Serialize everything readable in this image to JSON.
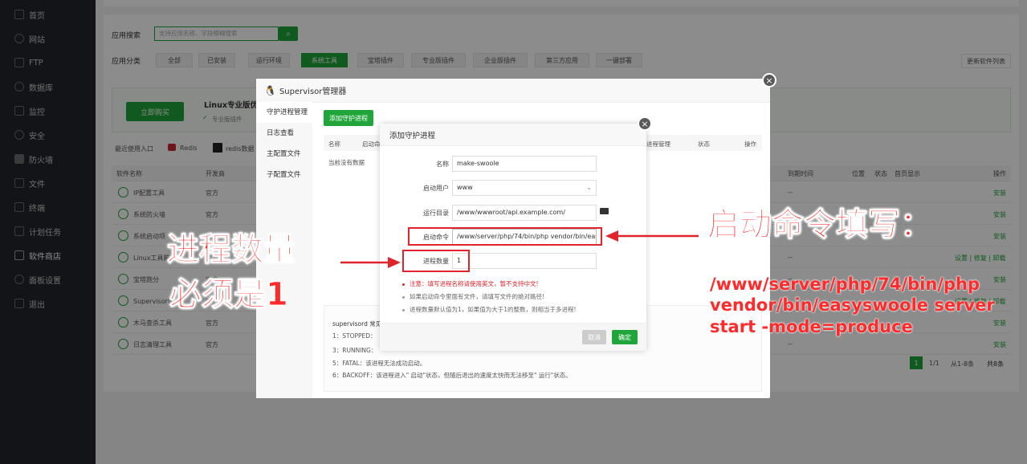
{
  "sidebar": {
    "items": [
      {
        "label": "首页",
        "icon": "home-icon"
      },
      {
        "label": "网站",
        "icon": "globe-icon"
      },
      {
        "label": "FTP",
        "icon": "ftp-icon"
      },
      {
        "label": "数据库",
        "icon": "database-icon"
      },
      {
        "label": "监控",
        "icon": "monitor-icon"
      },
      {
        "label": "安全",
        "icon": "shield-icon"
      },
      {
        "label": "防火墙",
        "icon": "firewall-icon"
      },
      {
        "label": "文件",
        "icon": "folder-icon"
      },
      {
        "label": "终端",
        "icon": "terminal-icon"
      },
      {
        "label": "计划任务",
        "icon": "calendar-icon"
      },
      {
        "label": "软件商店",
        "icon": "grid-icon"
      },
      {
        "label": "面板设置",
        "icon": "gear-icon"
      },
      {
        "label": "退出",
        "icon": "logout-icon"
      }
    ]
  },
  "store": {
    "search_label": "应用搜索",
    "search_placeholder": "支持应用名称、字段模糊搜索",
    "category_label": "应用分类",
    "categories": [
      "全部",
      "已安装",
      "运行环境",
      "系统工具",
      "宝塔插件",
      "专业版插件",
      "企业版插件",
      "第三方应用",
      "一键部署"
    ],
    "active_category": "系统工具",
    "update_list_button": "更新软件列表",
    "buy_button": "立即购买",
    "promo_title": "Linux专业版优",
    "promo_sub": "专业版插件",
    "recent_label": "最近使用入口",
    "recent_items": [
      "Redis",
      "redis数据"
    ],
    "table_headers": [
      "软件名称",
      "开发商",
      "到期时间",
      "位置",
      "状态",
      "首页显示",
      "操作"
    ],
    "rows": [
      {
        "name": "IP配置工具",
        "dev": "官方",
        "expire": "--",
        "op": "安装"
      },
      {
        "name": "系统防火墙",
        "dev": "官方",
        "expire": "--",
        "op": "安装"
      },
      {
        "name": "系统启动项",
        "dev": "官方",
        "expire": "--",
        "op": "安装"
      },
      {
        "name": "Linux工具箱",
        "dev": "官方",
        "expire": "--",
        "op": "设置 | 修复 | 卸载"
      },
      {
        "name": "宝塔跑分",
        "dev": "官方",
        "expire": "--",
        "op": "安装"
      },
      {
        "name": "Supervisor管",
        "dev": "官方",
        "expire": "--",
        "op": "设置 | 修复 | 卸载"
      },
      {
        "name": "木马查杀工具",
        "dev": "官方",
        "expire": "--",
        "op": "安装"
      },
      {
        "name": "日志清理工具",
        "dev": "官方",
        "expire": "--",
        "op": "安装"
      }
    ],
    "pagination": {
      "page": "1",
      "total_pages": "1/1",
      "range": "从1-8条",
      "count": "共8条"
    }
  },
  "supervisor": {
    "title": "Supervisor管理器",
    "menu": [
      "守护进程管理",
      "日志查看",
      "主配置文件",
      "子配置文件"
    ],
    "add_button": "添加守护进程",
    "table_headers": [
      "名称",
      "启动命",
      "进程管理",
      "状态",
      "操作"
    ],
    "empty_text": "当前没有数据",
    "status_title": "supervisord 常见",
    "status_lines": [
      "1：STOPPED：",
      "3：RUNNING：",
      "5：FATAL：该进程无法成功启动。",
      "6：BACKOFF：该进程进入\" 启动\"状态，但随后退出的速度太快而无法移至\" 运行\"状态。"
    ]
  },
  "dialog": {
    "title": "添加守护进程",
    "fields": {
      "name_label": "名称",
      "name_value": "make-swoole",
      "user_label": "启动用户",
      "user_value": "www",
      "dir_label": "运行目录",
      "dir_value": "/www/wwwroot/api.example.com/",
      "cmd_label": "启动命令",
      "cmd_value": "/www/server/php/74/bin/php vendor/bin/easyswo",
      "count_label": "进程数量",
      "count_value": "1"
    },
    "notes": [
      "注意：填写进程名称请使用英文，暂不支持中文!",
      "如果启动命令里面有文件，请填写文件的绝对路径!",
      "进程数量默认值为1，如果值为大于1的整数，则相当于多进程!"
    ],
    "cancel_button": "取消",
    "confirm_button": "确定"
  },
  "annotations": {
    "left_line1": "进程数量",
    "left_line2": "必须是1",
    "right_title": "启动命令填写：",
    "cmd_line1": "/www/server/php/74/bin/php",
    "cmd_line2": "vendor/bin/easyswoole  server",
    "cmd_line3": "start  -mode=produce"
  },
  "colors": {
    "brand_green": "#20a53a",
    "annotation_red": "#ff2a2a",
    "sidebar_bg": "#23262b"
  }
}
